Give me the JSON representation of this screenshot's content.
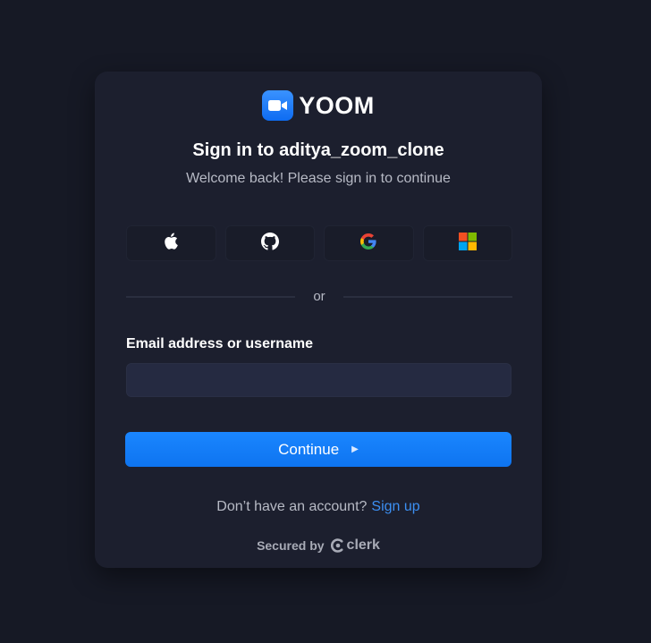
{
  "brand": {
    "name": "YOOM",
    "accent": "#0e6cf2"
  },
  "header": {
    "title": "Sign in to aditya_zoom_clone",
    "subtitle": "Welcome back! Please sign in to continue"
  },
  "social": [
    {
      "icon": "apple-icon"
    },
    {
      "icon": "github-icon"
    },
    {
      "icon": "google-icon"
    },
    {
      "icon": "microsoft-icon"
    }
  ],
  "divider": {
    "label": "or"
  },
  "form": {
    "email_label": "Email address or username",
    "email_value": "",
    "continue_label": "Continue"
  },
  "footer": {
    "no_account_text": "Don’t have an account?",
    "signup_label": "Sign up",
    "secured_by": "Secured by",
    "provider": "clerk"
  },
  "colors": {
    "background": "#161925",
    "card": "#1c1f2e",
    "primary_button": "#0e74f0",
    "link": "#3c8ff2"
  }
}
